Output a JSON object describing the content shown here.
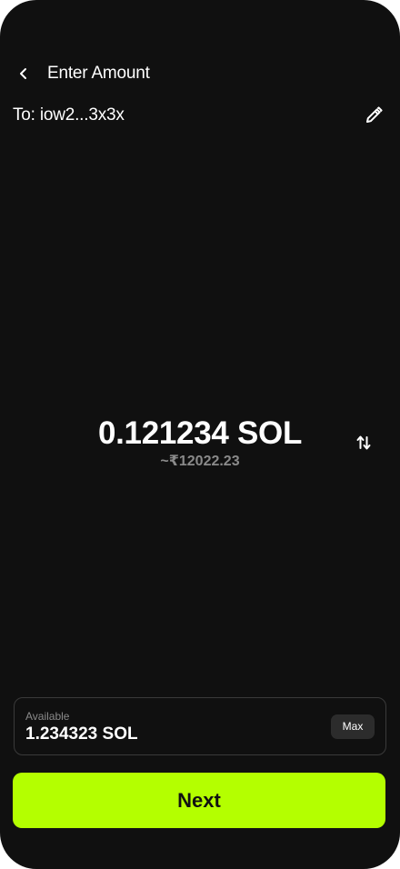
{
  "header": {
    "title": "Enter Amount",
    "back_icon": "chevron-left-icon"
  },
  "recipient": {
    "label": "To: iow2...3x3x",
    "edit_icon": "pencil-icon"
  },
  "amount": {
    "value": "0.121234 SOL",
    "fiat_equivalent": "~₹12022.23",
    "swap_icon": "swap-vertical-arrows-icon"
  },
  "balance": {
    "label": "Available",
    "value": "1.234323 SOL",
    "max_label": "Max"
  },
  "next_button": {
    "label": "Next"
  },
  "colors": {
    "background": "#101010",
    "accent": "#b4ff00",
    "muted_text": "#8a8a8a",
    "card_border": "#3a3a3a",
    "max_button_bg": "#2c2c2c"
  }
}
